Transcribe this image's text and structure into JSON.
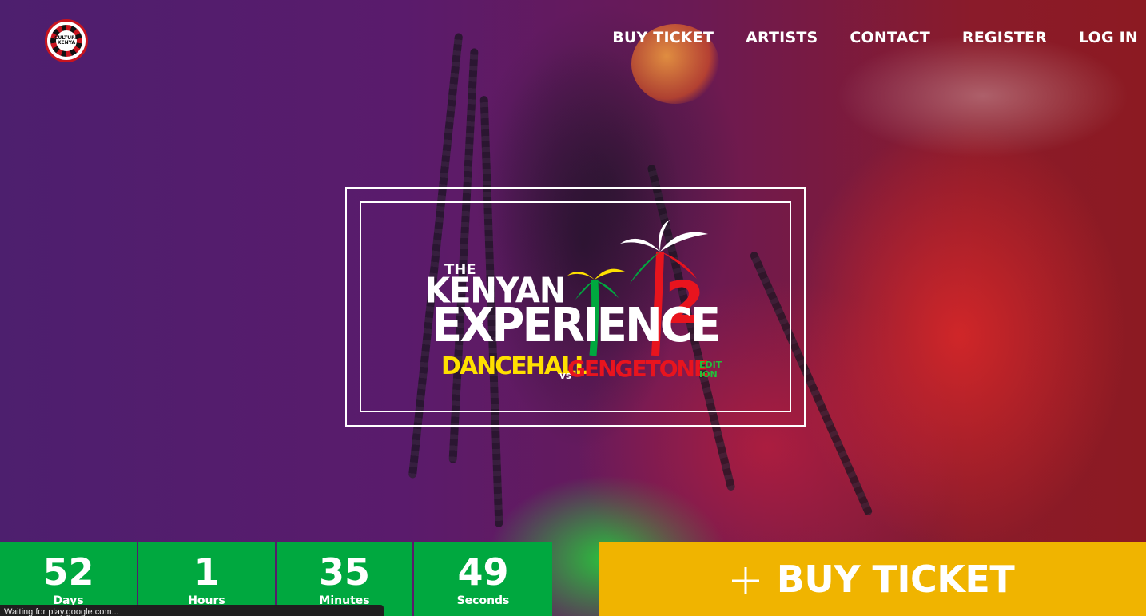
{
  "brand": {
    "logo_text": "CULTURE KENYA",
    "logo_icon": "culture-kenya-badge-icon"
  },
  "nav": {
    "items": [
      {
        "label": "BUY TICKET"
      },
      {
        "label": "ARTISTS"
      },
      {
        "label": "CONTACT"
      },
      {
        "label": "REGISTER"
      },
      {
        "label": "LOG IN"
      }
    ]
  },
  "event_logo": {
    "line1": "THE",
    "line2": "KENYAN",
    "line3": "EXPERIENCE",
    "edition_number": "2",
    "sub_left": "DANCEHALL",
    "sub_vs": "vs",
    "sub_right": "GENGETONE",
    "sub_edition": "EDIT ION",
    "icon": "palm-trees-icon"
  },
  "countdown": [
    {
      "value": "52",
      "label": "Days"
    },
    {
      "value": "1",
      "label": "Hours"
    },
    {
      "value": "35",
      "label": "Minutes"
    },
    {
      "value": "49",
      "label": "Seconds"
    }
  ],
  "cta": {
    "label": "BUY TICKET",
    "icon": "plus-icon"
  },
  "status_bar": {
    "text": "Waiting for play.google.com..."
  },
  "colors": {
    "countdown_green": "#00a83f",
    "cta_yellow": "#f0b400",
    "kenya_red": "#e8141e",
    "dancehall_yellow": "#ffe000",
    "hero_purple": "#5a1b6c"
  }
}
